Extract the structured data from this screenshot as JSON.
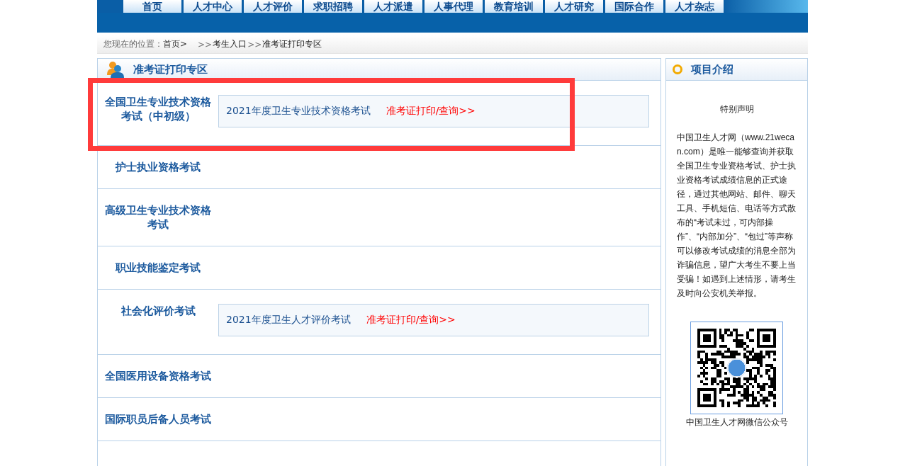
{
  "nav": {
    "tabs": [
      {
        "label": "首页",
        "selected": false
      },
      {
        "label": "人才中心",
        "selected": false
      },
      {
        "label": "人才评价",
        "selected": false
      },
      {
        "label": "求职招聘",
        "selected": false
      },
      {
        "label": "人才派遣",
        "selected": false
      },
      {
        "label": "人事代理",
        "selected": false
      },
      {
        "label": "教育培训",
        "selected": false
      },
      {
        "label": "人才研究",
        "selected": false
      },
      {
        "label": "国际合作",
        "selected": false
      },
      {
        "label": "人才杂志",
        "selected": false
      }
    ]
  },
  "breadcrumb": {
    "label": "您现在的位置：",
    "parts": [
      {
        "kind": "home",
        "text": "首页>"
      },
      {
        "kind": "separator",
        "text": ">>"
      },
      {
        "kind": "link",
        "text": "考生入口"
      },
      {
        "kind": "separator",
        "text": ">>"
      },
      {
        "kind": "current",
        "text": "准考证打印专区"
      }
    ]
  },
  "exam_panel": {
    "title": "准考证打印专区",
    "rows": [
      {
        "title": "全国卫生专业技术资格考试（中初级）",
        "highlighted": true,
        "exams": [
          {
            "name": "2021年度卫生专业技术资格考试",
            "link": "准考证打印/查询>>"
          }
        ]
      },
      {
        "title": "护士执业资格考试",
        "highlighted": false
      },
      {
        "title": "高级卫生专业技术资格考试",
        "highlighted": false
      },
      {
        "title": "职业技能鉴定考试",
        "highlighted": false
      },
      {
        "title": "社会化评价考试",
        "highlighted": false,
        "exams": [
          {
            "name": "2021年度卫生人才评价考试",
            "link": "准考证打印/查询>>"
          }
        ]
      },
      {
        "title": "全国医用设备资格考试",
        "highlighted": false
      },
      {
        "title": "国际职员后备人员考试",
        "highlighted": false
      }
    ]
  },
  "info_panel": {
    "title": "项目介绍",
    "heading": "特别声明",
    "body": "中国卫生人才网（www.21wecan.com）是唯一能够查询并获取全国卫生专业资格考试、护士执业资格考试成绩信息的正式途径，通过其他网站、邮件、聊天工具、手机短信、电话等方式散布的“考试未过，可内部操作”、“内部加分”、“包过”等声称可以修改考试成绩的消息全部为诈骗信息，望广大考生不要上当受骗！如遇到上述情形，请考生及时向公安机关举报。",
    "qr_caption": "中国卫生人才网微信公众号"
  }
}
